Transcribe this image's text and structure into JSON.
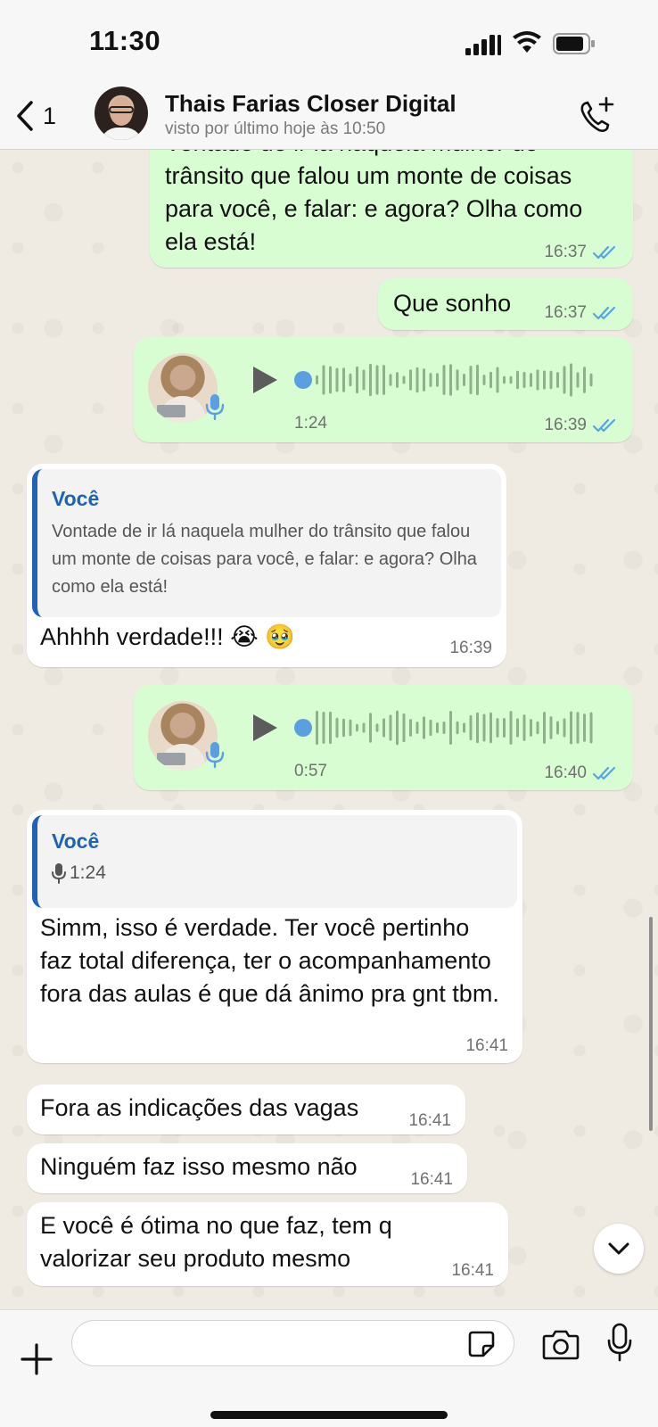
{
  "status_bar": {
    "time": "11:30"
  },
  "header": {
    "back_count": "1",
    "contact_name": "Thais Farias Closer Digital",
    "last_seen": "visto por último hoje às 10:50"
  },
  "messages": [
    {
      "direction": "out",
      "text": "Vontade de ir lá naquela mulher do trânsito que falou um monte de coisas para você, e falar: e agora? Olha como ela está!",
      "time": "16:37",
      "status": "read"
    },
    {
      "direction": "out",
      "text": "Que sonho",
      "time": "16:37",
      "status": "read"
    },
    {
      "direction": "out",
      "type": "audio",
      "duration": "1:24",
      "time": "16:39",
      "status": "read"
    },
    {
      "direction": "in",
      "quote_author": "Você",
      "quote_text": "Vontade de ir lá naquela mulher do trânsito que falou um monte de coisas para você, e falar: e agora? Olha como ela está!",
      "text": "Ahhhh verdade!!! 😭 🥹",
      "time": "16:39"
    },
    {
      "direction": "out",
      "type": "audio",
      "duration": "0:57",
      "time": "16:40",
      "status": "read"
    },
    {
      "direction": "in",
      "quote_author": "Você",
      "quote_audio": "1:24",
      "text": "Simm, isso é verdade. Ter você pertinho faz total diferença, ter o acompanhamento fora das aulas é que dá ânimo pra gnt tbm.",
      "time": "16:41"
    },
    {
      "direction": "in",
      "text": "Fora as indicações das vagas",
      "time": "16:41"
    },
    {
      "direction": "in",
      "text": "Ninguém faz isso mesmo não",
      "time": "16:41"
    },
    {
      "direction": "in",
      "text": "E você é ótima no que faz, tem q valorizar seu produto mesmo",
      "time": "16:41"
    }
  ],
  "visible_partial_lines": {
    "first_message": [
      "Vontade de ir lá naquela mulher do",
      "trânsito que falou um monte de coisas",
      "para você, e falar: e agora? Olha como",
      "ela está!"
    ]
  },
  "input": {
    "placeholder": "",
    "value": ""
  },
  "icons": [
    "signal-icon",
    "wifi-icon",
    "battery-icon",
    "back-chevron-icon",
    "add-call-icon",
    "play-icon",
    "microphone-icon",
    "double-check-icon",
    "chevron-down-icon",
    "plus-icon",
    "sticker-icon",
    "camera-icon"
  ],
  "colors": {
    "outgoing_bubble": "#d9fdd3",
    "incoming_bubble": "#ffffff",
    "accent_blue": "#1f62b8",
    "read_check": "#53a6e6"
  }
}
